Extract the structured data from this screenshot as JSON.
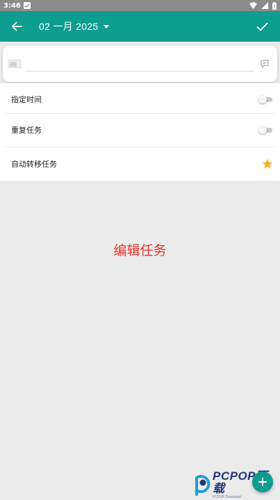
{
  "status_bar": {
    "time": "3:46"
  },
  "app_bar": {
    "title": "02 一月 2025"
  },
  "task_input": {
    "value": "",
    "placeholder": ""
  },
  "settings": {
    "items": [
      {
        "label": "指定时间",
        "control": "toggle",
        "on": false
      },
      {
        "label": "重复任务",
        "control": "toggle",
        "on": false
      },
      {
        "label": "自动转移任务",
        "control": "star",
        "active": true
      }
    ]
  },
  "caption": "编辑任务",
  "watermark": {
    "brand": "PCPOP下载",
    "sub": "PCPOP Download"
  },
  "colors": {
    "accent": "#0e9d91",
    "status_bar": "#8c8c8c",
    "caption": "#e8352c",
    "star": "#f4b223"
  }
}
